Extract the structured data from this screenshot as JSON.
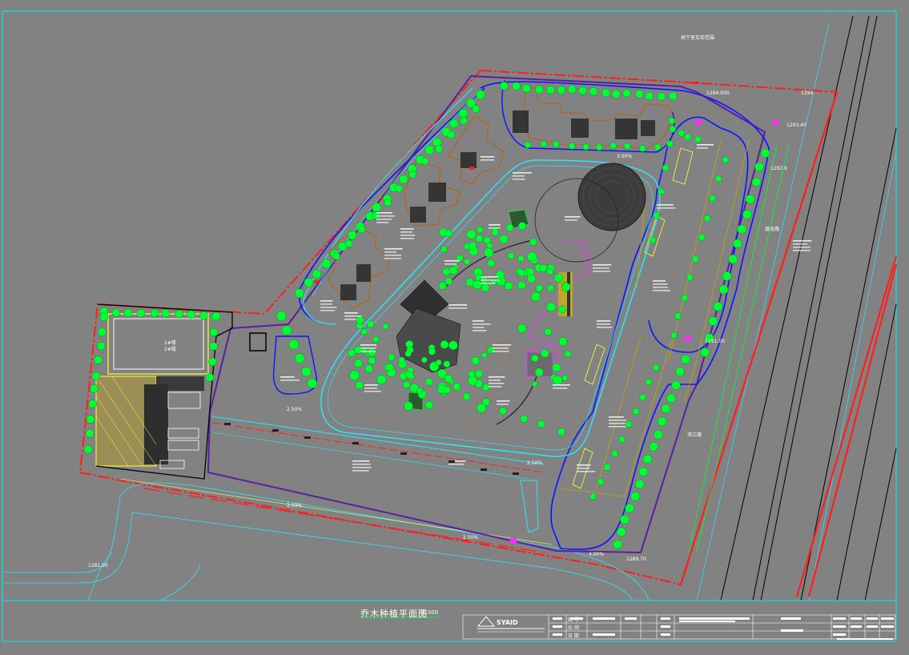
{
  "drawing": {
    "title": "乔木种植平面图",
    "scale": "1:300"
  },
  "labels": {
    "top_note": "地下室车库范围",
    "east_road": "银龙路",
    "east_road_2": "滨江路",
    "elev_1": "1294.900",
    "elev_2": "1294",
    "elev_3": "1293.40",
    "elev_4": "1292.6",
    "elev_5": "1291.00",
    "elev_6": "1289.70",
    "elev_7": "1281.00",
    "slope_1": "2.50%",
    "slope_2": "2.50%",
    "slope_3": "2.50%",
    "slope_4": "4.00%",
    "slope_5": "2.50%",
    "slope_6": "3.00%",
    "building_a": "1#楼",
    "building_b": "2#楼",
    "logo": "SYAID"
  },
  "title_block": {
    "rows": [
      "图 号",
      "比 例",
      "日 期"
    ]
  },
  "colors": {
    "background": "#828282",
    "frame": "#00e5e5",
    "red_line": "#ff1e1e",
    "tree": "#00ff33",
    "blue_road": "#0a14ff",
    "purple": "#5a1ea0",
    "cyan_path": "#29e6ff",
    "magenta": "#ff2bff",
    "orange_building": "#b3661e"
  }
}
